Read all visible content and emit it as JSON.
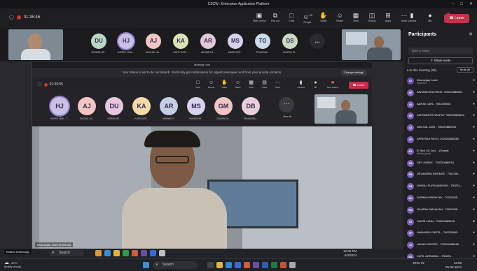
{
  "window": {
    "title": "CSCW : Enterprise Application Platform",
    "controls": [
      "–",
      "□",
      "✕"
    ]
  },
  "toolbar": {
    "timer": "01:35:46",
    "items": [
      {
        "label": "Take control",
        "icon": "monitor-icon"
      },
      {
        "label": "Pop out",
        "icon": "popout-icon"
      },
      {
        "label": "Chat",
        "icon": "chat-icon"
      },
      {
        "label": "People",
        "icon": "people-icon",
        "count": "29"
      },
      {
        "label": "Raise",
        "icon": "hand-icon"
      },
      {
        "label": "React",
        "icon": "smile-icon"
      },
      {
        "label": "View",
        "icon": "grid-icon"
      },
      {
        "label": "Rooms",
        "icon": "rooms-icon"
      },
      {
        "label": "Apps",
        "icon": "apps-icon"
      },
      {
        "label": "More",
        "icon": "more-icon"
      }
    ],
    "camera_label": "Camera",
    "mic_label": "Mic",
    "share_label": "Share",
    "leave_label": "Leave"
  },
  "gallery": {
    "participants": [
      {
        "initials": "DU",
        "name": "DURMA UP...",
        "color": "#b9d8c4"
      },
      {
        "initials": "HJ",
        "name": "HARSH JAIN ...",
        "color": "#c9c1e6"
      },
      {
        "initials": "AJ",
        "name": "ANCHAL JA...",
        "color": "#f3c6c4"
      },
      {
        "initials": "KA",
        "name": "KAPIL AGR...",
        "color": "#d9e3b4"
      },
      {
        "initials": "AR",
        "name": "ASHWIN R...",
        "color": "#e2c7d7"
      },
      {
        "initials": "MS",
        "name": "MANOVEE...",
        "color": "#d8d2ee"
      },
      {
        "initials": "TG",
        "name": "TEJASWA...",
        "color": "#c8dbe8"
      },
      {
        "initials": "DS",
        "name": "DHIRAJ SI...",
        "color": "#c9d9c3"
      }
    ],
    "more_label": "..."
  },
  "panel": {
    "title": "Participants",
    "close": "✕",
    "search_placeholder": "Type a name",
    "share_invite": "Share invite",
    "in_meeting": "In this meeting (29)",
    "mute_all": "Mute all",
    "people": [
      {
        "initials": "DJ",
        "name": "Dhananjay Joshi",
        "sub": "Organizer",
        "color": "#6b4ea8"
      },
      {
        "initials": "AP",
        "name": "AAKANKSHA PATEL 700220880554",
        "sub": "",
        "color": "#7b5eb8"
      },
      {
        "initials": "AS",
        "name": "AARAV JAIN - 7002200810",
        "sub": "",
        "color": "#7b5eb8"
      },
      {
        "initials": "AR",
        "name": "AISHWARYA RAJPUT 700220880534",
        "sub": "",
        "color": "#7b5eb8"
      },
      {
        "initials": "AJ",
        "name": "ANCHAL JAIN - 700220880540",
        "sub": "",
        "color": "#7b5eb8"
      },
      {
        "initials": "AP",
        "name": "APRESHA PATEL 700220880538",
        "sub": "",
        "color": "#7b5eb8"
      },
      {
        "initials": "BT",
        "name": "B Tech CE 2nd ... (Guest)",
        "sub": "Meeting guest",
        "color": "#7b5eb8"
      },
      {
        "initials": "DS",
        "name": "DEV SARAF - 700220880510",
        "sub": "",
        "color": "#7b5eb8"
      },
      {
        "initials": "DB",
        "name": "DEVANSHU BHONDE - 7002200...",
        "sub": "",
        "color": "#7b5eb8"
      },
      {
        "initials": "DS",
        "name": "DHIRAJ SURYAWANSHI - 700223...",
        "sub": "",
        "color": "#7b5eb8"
      },
      {
        "initials": "DU",
        "name": "DURMA UPADHYAY - 70022085...",
        "sub": "",
        "color": "#7b5eb8"
      },
      {
        "initials": "GM",
        "name": "GAURAV MAHAJAN - 70022008...",
        "sub": "",
        "color": "#7b5eb8"
      },
      {
        "initials": "HJ",
        "name": "HARSH JAIN - 700220880815",
        "sub": "",
        "color": "#7b5eb8"
      },
      {
        "initials": "HP",
        "name": "HIMANSHU PATEL - 700220880...",
        "sub": "",
        "color": "#7b5eb8"
      },
      {
        "initials": "JD",
        "name": "JAHNVI DEORE - 700220880548",
        "sub": "",
        "color": "#7b5eb8"
      },
      {
        "initials": "KA",
        "name": "KAPIL AGRAWAL - 700220...",
        "sub": "",
        "color": "#7b5eb8"
      }
    ]
  },
  "inner": {
    "title": "Meeting now",
    "notice": "Your status is set to do not disturb. You'll only get notifications for urgent messages and from your priority contacts.",
    "change_settings": "Change settings",
    "timer": "01:35:55",
    "items": [
      {
        "label": "Chat",
        "icon": "chat-icon"
      },
      {
        "label": "People",
        "icon": "people-icon"
      },
      {
        "label": "Raise",
        "icon": "hand-icon"
      },
      {
        "label": "React",
        "icon": "smile-icon"
      },
      {
        "label": "View",
        "icon": "grid-icon"
      },
      {
        "label": "Notes",
        "icon": "notes-icon"
      },
      {
        "label": "More",
        "icon": "more-icon"
      }
    ],
    "camera_label": "Camera",
    "mic_label": "Mic",
    "share_label": "Stop sharing",
    "leave_label": "Leave",
    "tooltip": "29 participants. Show participants",
    "participants": [
      {
        "initials": "HJ",
        "name": "HARSH JAIN - 7...",
        "color": "#c9c1e6"
      },
      {
        "initials": "AJ",
        "name": "ANCHAL JA...",
        "color": "#f3c6c4"
      },
      {
        "initials": "DU",
        "name": "DURMA UP...",
        "color": "#e6c7de"
      },
      {
        "initials": "KA",
        "name": "KAPIL AGR...",
        "color": "#f6d9a8"
      },
      {
        "initials": "AR",
        "name": "ASHWIN R...",
        "color": "#c3cfe3"
      },
      {
        "initials": "MS",
        "name": "MANSOOR...",
        "color": "#d8d2ee"
      },
      {
        "initials": "GM",
        "name": "GAURAV M...",
        "color": "#f0c6c2"
      },
      {
        "initials": "DB",
        "name": "DEVANSHU...",
        "color": "#e8d0d8"
      }
    ],
    "view_all": "View all",
    "presenter_label": "Dhananjay Joshi (External)"
  },
  "taskbar": {
    "search_label": "Search",
    "weather_temp": "29°C",
    "weather_desc": "Mostly cloudy",
    "inner_time": "12:05 PM",
    "inner_date": "5/3/2024",
    "time": "12:05",
    "date": "05-03-2024",
    "lang": "ENG IN",
    "presenter_badge": "Kataria Dhananjay",
    "weather_icon": "cloud-icon"
  }
}
